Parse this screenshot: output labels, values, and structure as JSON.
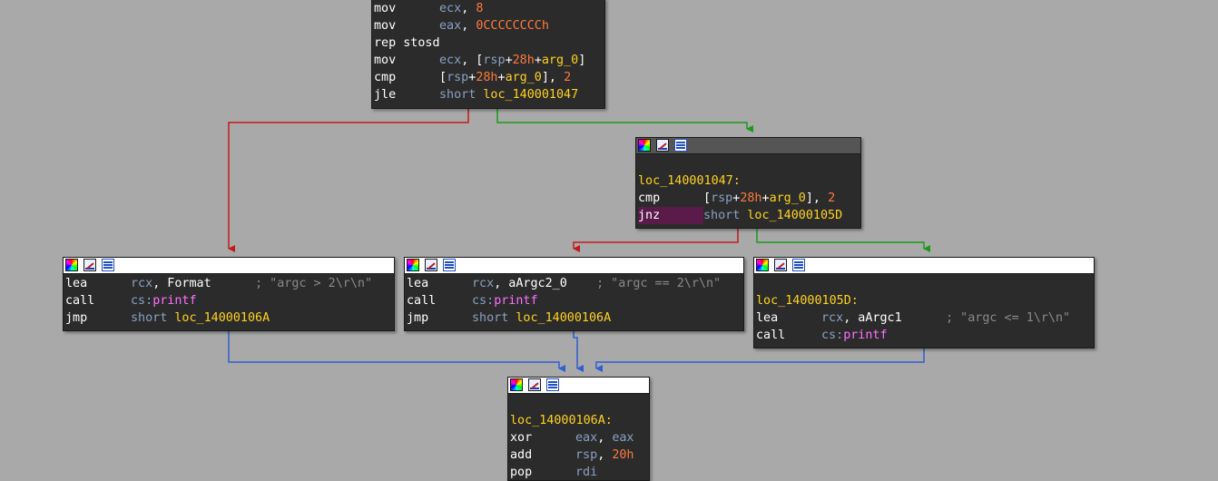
{
  "colors": {
    "canvas_bg": "#a9a9a9",
    "node_bg": "#2b2b2b",
    "register": "#8aa0c2",
    "number": "#ff7a3c",
    "label": "#ffd21f",
    "function": "#ff6fff",
    "comment": "#8a8a8a",
    "edge_true": "#1a9a1a",
    "edge_false": "#c21a1a",
    "edge_uncond": "#2f5fd0"
  },
  "node_header_icons": [
    "color-palette-icon",
    "edit-node-icon",
    "graph-overview-icon"
  ],
  "nodes": {
    "top": {
      "lines": [
        {
          "mnemonic": "mov",
          "ops": [
            {
              "t": "ecx",
              "c": "reg"
            },
            {
              "t": ", ",
              "c": "plain"
            },
            {
              "t": "8",
              "c": "num"
            }
          ]
        },
        {
          "mnemonic": "mov",
          "ops": [
            {
              "t": "eax",
              "c": "reg"
            },
            {
              "t": ", ",
              "c": "plain"
            },
            {
              "t": "0CCCCCCCCh",
              "c": "num"
            }
          ]
        },
        {
          "mnemonic": "rep stosd",
          "ops": []
        },
        {
          "mnemonic": "mov",
          "ops": [
            {
              "t": "ecx",
              "c": "reg"
            },
            {
              "t": ", [",
              "c": "plain"
            },
            {
              "t": "rsp",
              "c": "reg"
            },
            {
              "t": "+",
              "c": "plain"
            },
            {
              "t": "28h",
              "c": "num"
            },
            {
              "t": "+",
              "c": "plain"
            },
            {
              "t": "arg_0",
              "c": "lbl"
            },
            {
              "t": "]",
              "c": "plain"
            }
          ]
        },
        {
          "mnemonic": "cmp",
          "ops": [
            {
              "t": "[",
              "c": "plain"
            },
            {
              "t": "rsp",
              "c": "reg"
            },
            {
              "t": "+",
              "c": "plain"
            },
            {
              "t": "28h",
              "c": "num"
            },
            {
              "t": "+",
              "c": "plain"
            },
            {
              "t": "arg_0",
              "c": "lbl"
            },
            {
              "t": "], ",
              "c": "plain"
            },
            {
              "t": "2",
              "c": "num"
            }
          ]
        },
        {
          "mnemonic": "jle",
          "ops": [
            {
              "t": "short ",
              "c": "reg"
            },
            {
              "t": "loc_140001047",
              "c": "lbl"
            }
          ]
        }
      ]
    },
    "cmp_block": {
      "label": "loc_140001047:",
      "lines": [
        {
          "mnemonic": "cmp",
          "ops": [
            {
              "t": "[",
              "c": "plain"
            },
            {
              "t": "rsp",
              "c": "reg"
            },
            {
              "t": "+",
              "c": "plain"
            },
            {
              "t": "28h",
              "c": "num"
            },
            {
              "t": "+",
              "c": "plain"
            },
            {
              "t": "arg_0",
              "c": "lbl"
            },
            {
              "t": "], ",
              "c": "plain"
            },
            {
              "t": "2",
              "c": "num"
            }
          ]
        },
        {
          "mnemonic": "jnz",
          "highlight": true,
          "ops": [
            {
              "t": "short ",
              "c": "reg"
            },
            {
              "t": "loc_14000105D",
              "c": "lbl"
            }
          ]
        }
      ]
    },
    "gt_block": {
      "lines": [
        {
          "mnemonic": "lea",
          "ops": [
            {
              "t": "rcx",
              "c": "reg"
            },
            {
              "t": ", Format      ",
              "c": "plain"
            },
            {
              "t": "; \"argc > 2\\r\\n\"",
              "c": "cm"
            }
          ]
        },
        {
          "mnemonic": "call",
          "ops": [
            {
              "t": "cs:",
              "c": "reg"
            },
            {
              "t": "printf",
              "c": "fn"
            }
          ]
        },
        {
          "mnemonic": "jmp",
          "ops": [
            {
              "t": "short ",
              "c": "reg"
            },
            {
              "t": "loc_14000106A",
              "c": "lbl"
            }
          ]
        }
      ]
    },
    "eq_block": {
      "lines": [
        {
          "mnemonic": "lea",
          "ops": [
            {
              "t": "rcx",
              "c": "reg"
            },
            {
              "t": ", aArgc2_0    ",
              "c": "plain"
            },
            {
              "t": "; \"argc == 2\\r\\n\"",
              "c": "cm"
            }
          ]
        },
        {
          "mnemonic": "call",
          "ops": [
            {
              "t": "cs:",
              "c": "reg"
            },
            {
              "t": "printf",
              "c": "fn"
            }
          ]
        },
        {
          "mnemonic": "jmp",
          "ops": [
            {
              "t": "short ",
              "c": "reg"
            },
            {
              "t": "loc_14000106A",
              "c": "lbl"
            }
          ]
        }
      ]
    },
    "le_block": {
      "label": "loc_14000105D:",
      "lines": [
        {
          "mnemonic": "lea",
          "ops": [
            {
              "t": "rcx",
              "c": "reg"
            },
            {
              "t": ", aArgc1      ",
              "c": "plain"
            },
            {
              "t": "; \"argc <= 1\\r\\n\"",
              "c": "cm"
            }
          ]
        },
        {
          "mnemonic": "call",
          "ops": [
            {
              "t": "cs:",
              "c": "reg"
            },
            {
              "t": "printf",
              "c": "fn"
            }
          ]
        }
      ]
    },
    "exit_block": {
      "label": "loc_14000106A:",
      "lines": [
        {
          "mnemonic": "xor",
          "ops": [
            {
              "t": "eax",
              "c": "reg"
            },
            {
              "t": ", ",
              "c": "plain"
            },
            {
              "t": "eax",
              "c": "reg"
            }
          ]
        },
        {
          "mnemonic": "add",
          "ops": [
            {
              "t": "rsp",
              "c": "reg"
            },
            {
              "t": ", ",
              "c": "plain"
            },
            {
              "t": "20h",
              "c": "num"
            }
          ]
        },
        {
          "mnemonic": "pop",
          "ops": [
            {
              "t": "rdi",
              "c": "reg"
            }
          ]
        }
      ]
    }
  }
}
